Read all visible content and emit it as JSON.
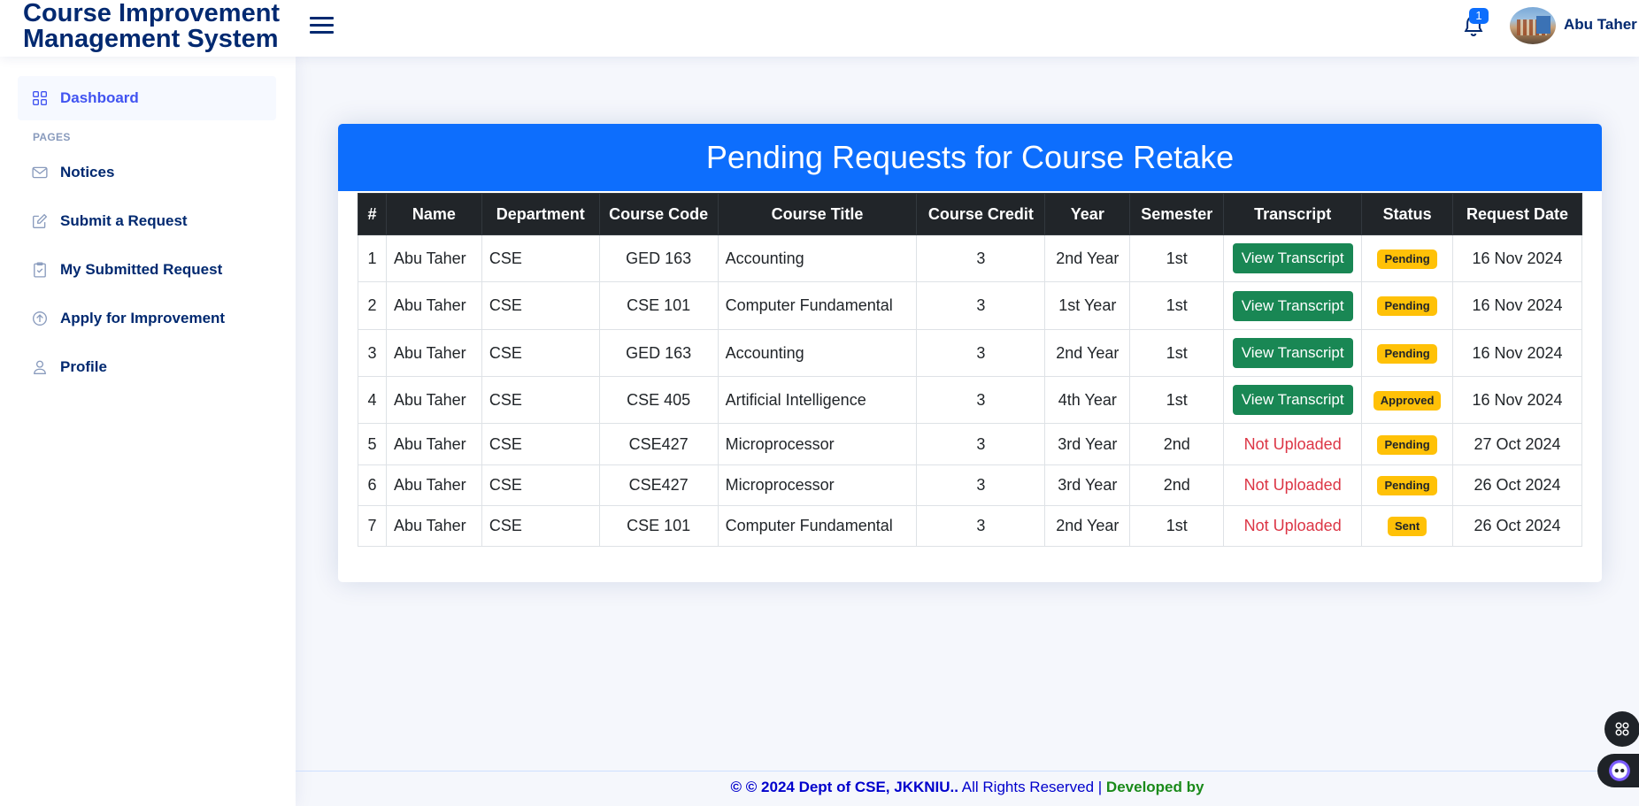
{
  "header": {
    "logo_line1": "Course Improvement",
    "logo_line2": "Management System",
    "notification_count": "1",
    "user_name": "Abu Taher ▾"
  },
  "sidebar": {
    "items": [
      {
        "label": "Dashboard",
        "icon": "grid-icon"
      },
      {
        "label": "Notices",
        "icon": "envelope-icon"
      },
      {
        "label": "Submit a Request",
        "icon": "pencil-square-icon"
      },
      {
        "label": "My Submitted Request",
        "icon": "clipboard-check-icon"
      },
      {
        "label": "Apply for Improvement",
        "icon": "arrow-up-circle-icon"
      },
      {
        "label": "Profile",
        "icon": "person-icon"
      }
    ],
    "heading_pages": "PAGES"
  },
  "card": {
    "title": "Pending Requests for Course Retake"
  },
  "table": {
    "columns": [
      "#",
      "Name",
      "Department",
      "Course Code",
      "Course Title",
      "Course Credit",
      "Year",
      "Semester",
      "Transcript",
      "Status",
      "Request Date"
    ],
    "rows": [
      {
        "n": "1",
        "name": "Abu Taher",
        "dept": "CSE",
        "code": "GED 163",
        "title": "Accounting",
        "credit": "3",
        "year": "2nd Year",
        "semester": "1st",
        "transcript": "View Transcript",
        "status": "Pending",
        "date": "16 Nov 2024"
      },
      {
        "n": "2",
        "name": "Abu Taher",
        "dept": "CSE",
        "code": "CSE 101",
        "title": "Computer Fundamental",
        "credit": "3",
        "year": "1st Year",
        "semester": "1st",
        "transcript": "View Transcript",
        "status": "Pending",
        "date": "16 Nov 2024"
      },
      {
        "n": "3",
        "name": "Abu Taher",
        "dept": "CSE",
        "code": "GED 163",
        "title": "Accounting",
        "credit": "3",
        "year": "2nd Year",
        "semester": "1st",
        "transcript": "View Transcript",
        "status": "Pending",
        "date": "16 Nov 2024"
      },
      {
        "n": "4",
        "name": "Abu Taher",
        "dept": "CSE",
        "code": "CSE 405",
        "title": "Artificial Intelligence",
        "credit": "3",
        "year": "4th Year",
        "semester": "1st",
        "transcript": "View Transcript",
        "status": "Approved",
        "date": "16 Nov 2024"
      },
      {
        "n": "5",
        "name": "Abu Taher",
        "dept": "CSE",
        "code": "CSE427",
        "title": "Microprocessor",
        "credit": "3",
        "year": "3rd Year",
        "semester": "2nd",
        "transcript": "Not Uploaded",
        "status": "Pending",
        "date": "27 Oct 2024"
      },
      {
        "n": "6",
        "name": "Abu Taher",
        "dept": "CSE",
        "code": "CSE427",
        "title": "Microprocessor",
        "credit": "3",
        "year": "3rd Year",
        "semester": "2nd",
        "transcript": "Not Uploaded",
        "status": "Pending",
        "date": "26 Oct 2024"
      },
      {
        "n": "7",
        "name": "Abu Taher",
        "dept": "CSE",
        "code": "CSE 101",
        "title": "Computer Fundamental",
        "credit": "3",
        "year": "2nd Year",
        "semester": "1st",
        "transcript": "Not Uploaded",
        "status": "Sent",
        "date": "26 Oct 2024"
      }
    ]
  },
  "footer": {
    "part1": "© © 2024 Dept of CSE, JKKNIU..",
    "part2": " All Rights Reserved | ",
    "part3": "Developed by"
  },
  "colors": {
    "primary": "#0d6efd",
    "navy": "#012970",
    "accent": "#4154f1",
    "success": "#198754",
    "warning": "#ffc107",
    "danger": "#dc3545"
  }
}
